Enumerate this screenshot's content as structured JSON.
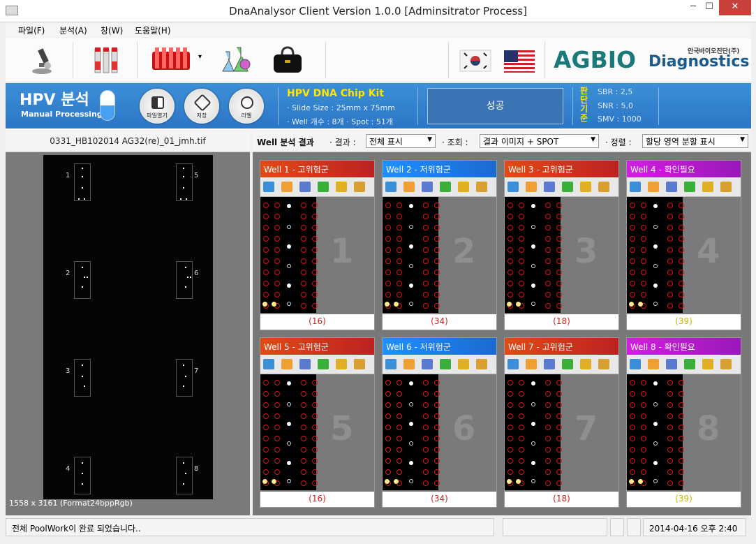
{
  "window": {
    "title": "DnaAnalysor Client Version 1.0.0 [Adminsitrator Process]",
    "min": "─",
    "max": "☐",
    "close": "✕"
  },
  "menu": [
    "파일(F)",
    "분석(A)",
    "창(W)",
    "도움말(H)"
  ],
  "toolbar": {
    "icons": [
      "microscope-icon",
      "test-tubes-icon",
      "tube-rack-icon",
      "flasks-icon",
      "bag-icon",
      "korea-flag-icon",
      "usa-flag-icon"
    ],
    "dropdown_arrow": "▾"
  },
  "logo": {
    "ag": "AGBIO",
    "dx": "Diagnostics",
    "kr": "안국바이오진단(주)"
  },
  "banner": {
    "title": "HPV 분석",
    "subtitle": "Manual Processing",
    "buttons": [
      "파일열기",
      "저장",
      "라벨"
    ],
    "kit_title": "HPV DNA Chip Kit",
    "slide_size": "· Slide Size : 25mm x 75mm",
    "well_info": "· Well 개수 : 8개 · Spot : 51개",
    "result": "성공",
    "criteria_label": "판단기준",
    "criteria": [
      "SBR : 2,5",
      "SNR : 5,0",
      "SMV : 1000"
    ]
  },
  "left": {
    "file_name": "0331_HB102014 AG32(re)_01_jmh.tif",
    "well_numbers": [
      "1",
      "2",
      "3",
      "4",
      "5",
      "6",
      "7",
      "8"
    ],
    "image_info": "1558 x 3161 (Format24bppRgb)"
  },
  "filter": {
    "header": "Well 분석 결과",
    "result_label": "· 결과 :",
    "result_value": "전체 표시",
    "view_label": "· 조회 :",
    "view_value": "결과 이미지 + SPOT",
    "sort_label": "· 정렬 :",
    "sort_value": "할당 영역 분할 표시"
  },
  "wells": [
    {
      "label": "Well 1 - 고위험군",
      "num": "1",
      "count": "(16)",
      "color": "#cc2222"
    },
    {
      "label": "Well 2 - 저위험군",
      "num": "2",
      "count": "(34)",
      "color": "#cc2222"
    },
    {
      "label": "Well 3 - 고위험군",
      "num": "3",
      "count": "(18)",
      "color": "#cc2222"
    },
    {
      "label": "Well 4 - 확인필요",
      "num": "4",
      "count": "(39)",
      "color": "#c8b400"
    },
    {
      "label": "Well 5 - 고위험군",
      "num": "5",
      "count": "(16)",
      "color": "#cc2222"
    },
    {
      "label": "Well 6 - 저위험군",
      "num": "6",
      "count": "(34)",
      "color": "#cc2222"
    },
    {
      "label": "Well 7 - 고위험군",
      "num": "7",
      "count": "(18)",
      "color": "#cc2222"
    },
    {
      "label": "Well 8 - 확인필요",
      "num": "8",
      "count": "(39)",
      "color": "#c8b400"
    }
  ],
  "status": {
    "message": "전체 PoolWork이 완료 되었습니다..",
    "datetime": "2014-04-16 오후 2:40"
  }
}
